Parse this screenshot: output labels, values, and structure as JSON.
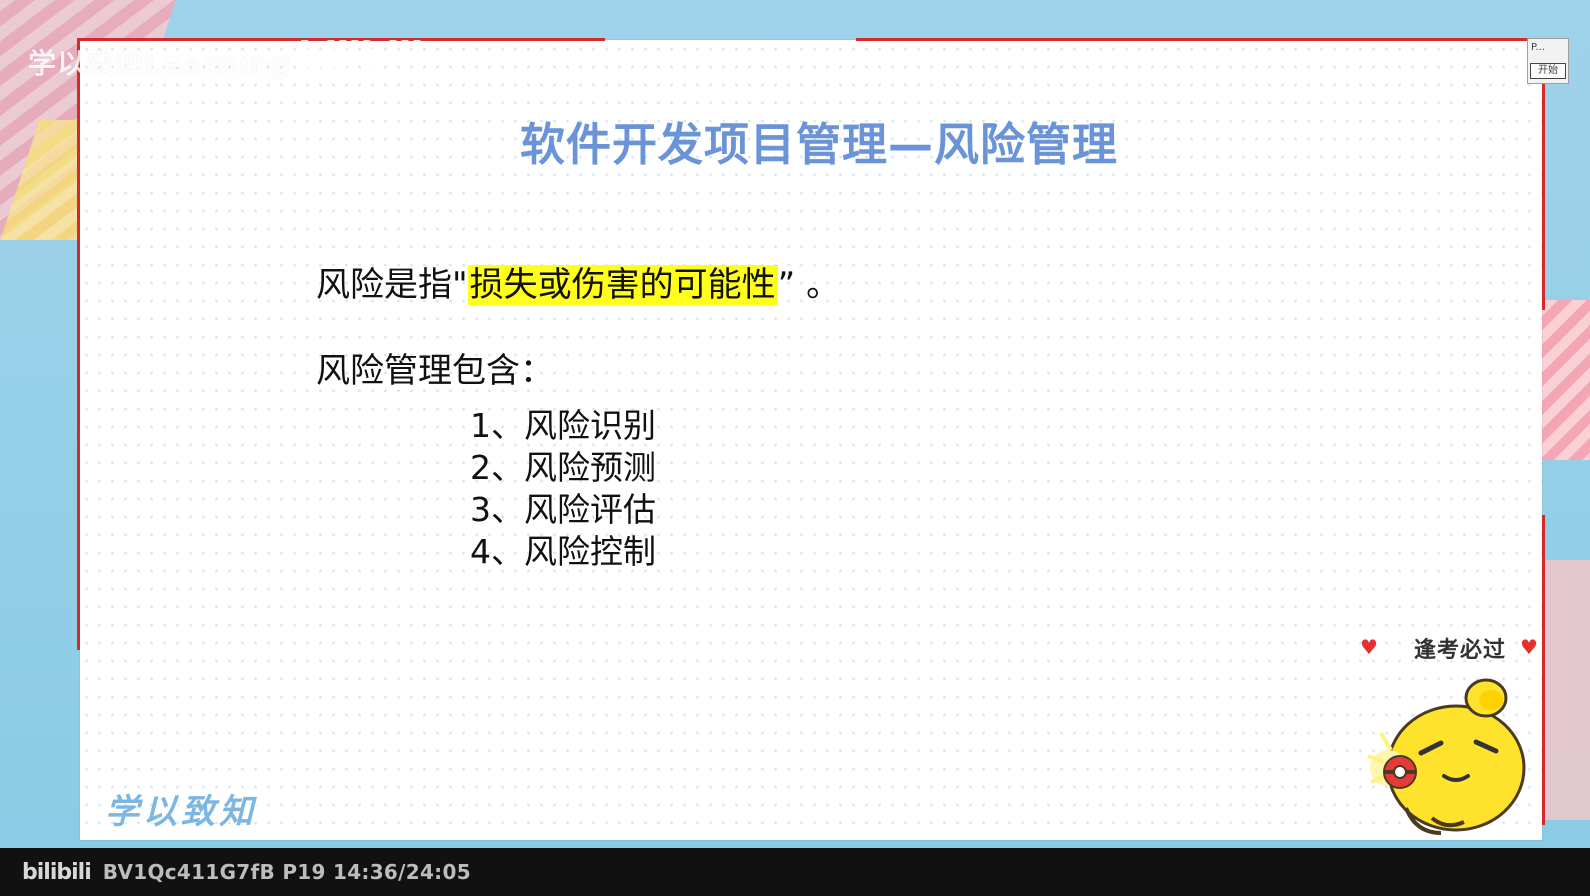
{
  "watermark": {
    "text": "学以致知Learning",
    "bilibili": "bilibili"
  },
  "slide": {
    "title": "软件开发项目管理—风险管理",
    "definition_prefix": "风险是指\"",
    "definition_highlight": "损失或伤害的可能性",
    "definition_suffix": "” 。",
    "management_heading": "风险管理包含：",
    "items": [
      "1、风险识别",
      "2、风险预测",
      "3、风险评估",
      "4、风险控制"
    ]
  },
  "widget": {
    "top_text": "P...",
    "button_label": "开始"
  },
  "decor": {
    "badge_text": "逢考必过",
    "bottom_left_logo": "学以致知"
  },
  "status": {
    "logo": "bilibili",
    "text": "BV1Qc411G7fB P19 14:36/24:05"
  },
  "colors": {
    "title": "#6a93d8",
    "highlight": "#ffff1a",
    "border": "#d62a2a"
  }
}
